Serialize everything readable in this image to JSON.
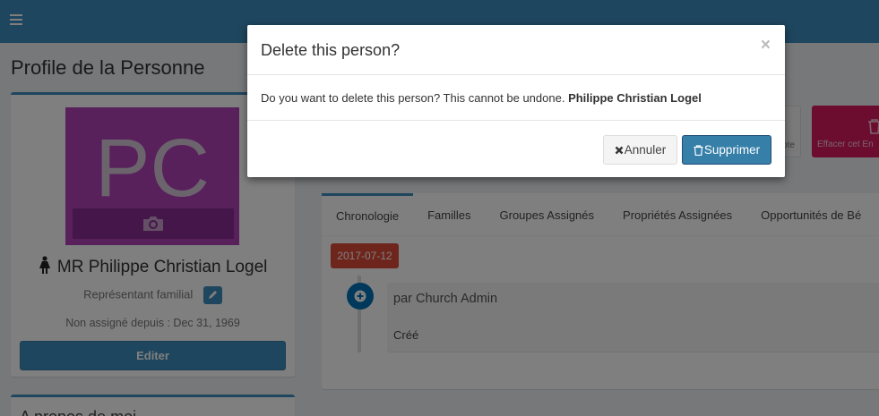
{
  "page": {
    "title": "Profile de la Personne"
  },
  "profile": {
    "initials": "PC",
    "name": "MR Philippe Christian Logel",
    "role": "Représentant familial",
    "since": "Non assigné depuis : Dec 31, 1969",
    "edit_label": "Editer"
  },
  "about": {
    "title": "A propos de moi"
  },
  "actions": {
    "note_label": "ote",
    "delete_entity_label": "Effacer cet En"
  },
  "tabs": [
    {
      "label": "Chronologie"
    },
    {
      "label": "Familles"
    },
    {
      "label": "Groupes Assignés"
    },
    {
      "label": "Propriétés Assignées"
    },
    {
      "label": "Opportunités de Bé"
    }
  ],
  "timeline": {
    "date": "2017-07-12",
    "header": "par Church Admin",
    "body": "Créé"
  },
  "modal": {
    "title": "Delete this person?",
    "close_symbol": "×",
    "message": "Do you want to delete this person? This cannot be undone.",
    "person_name": "Philippe Christian Logel",
    "cancel_label": "Annuler",
    "confirm_label": "Supprimer"
  },
  "colors": {
    "navbar": "#3c8dbc",
    "avatar_bg": "#b043b8",
    "danger": "#d81b60",
    "date_label": "#dd4b39",
    "primary_button": "#367fa9"
  }
}
